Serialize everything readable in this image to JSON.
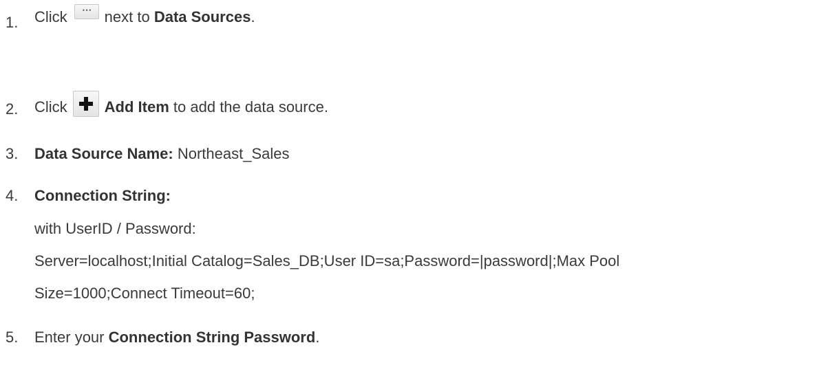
{
  "steps": [
    {
      "number": "1.",
      "pre": "Click",
      "icon": "ellipsis-icon",
      "icon_glyph": "⋯",
      "mid": "next to ",
      "bold": "Data Sources",
      "post": "."
    },
    {
      "number": "2.",
      "pre": "Click",
      "icon": "plus-icon",
      "bold": "Add Item",
      "post": " to add the data source."
    },
    {
      "number": "3.",
      "bold": "Data Source Name:",
      "post": " Northeast_Sales"
    },
    {
      "number": "4.",
      "bold": "Connection String:",
      "lines": [
        "with UserID / Password:",
        "Server=localhost;Initial Catalog=Sales_DB;User ID=sa;Password=|password|;Max Pool",
        "Size=1000;Connect Timeout=60;"
      ]
    },
    {
      "number": "5.",
      "pre": "Enter your ",
      "bold": "Connection String Password",
      "post": "."
    }
  ]
}
